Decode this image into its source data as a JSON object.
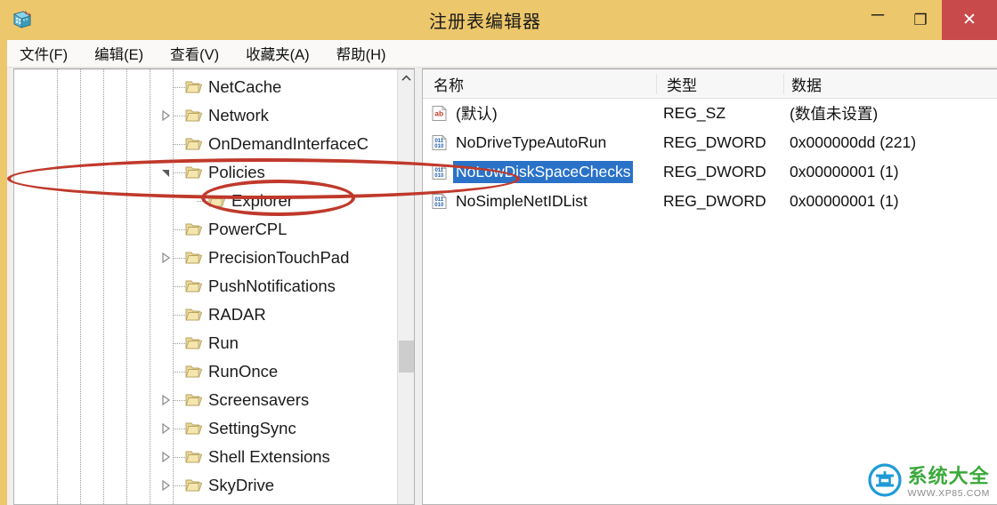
{
  "window": {
    "title": "注册表编辑器",
    "app_icon": "registry-editor-icon",
    "titlebar_color": "#edc76b",
    "close_color": "#c94a4a",
    "controls": {
      "minimize": "─",
      "maximize": "❐",
      "close": "✕"
    }
  },
  "menu": {
    "items": [
      {
        "label": "文件(F)",
        "name": "menu-file"
      },
      {
        "label": "编辑(E)",
        "name": "menu-edit"
      },
      {
        "label": "查看(V)",
        "name": "menu-view"
      },
      {
        "label": "收藏夹(A)",
        "name": "menu-favorites"
      },
      {
        "label": "帮助(H)",
        "name": "menu-help"
      }
    ]
  },
  "tree": {
    "items": [
      {
        "label": "NetCache",
        "indent": 0,
        "twisty": "none",
        "selected": false
      },
      {
        "label": "Network",
        "indent": 0,
        "twisty": "collapsed",
        "selected": false
      },
      {
        "label": "OnDemandInterfaceC",
        "indent": 0,
        "twisty": "none",
        "selected": false
      },
      {
        "label": "Policies",
        "indent": 0,
        "twisty": "expanded",
        "selected": false
      },
      {
        "label": "Explorer",
        "indent": 1,
        "twisty": "none",
        "selected": false
      },
      {
        "label": "PowerCPL",
        "indent": 0,
        "twisty": "none",
        "selected": false
      },
      {
        "label": "PrecisionTouchPad",
        "indent": 0,
        "twisty": "collapsed",
        "selected": false
      },
      {
        "label": "PushNotifications",
        "indent": 0,
        "twisty": "none",
        "selected": false
      },
      {
        "label": "RADAR",
        "indent": 0,
        "twisty": "none",
        "selected": false
      },
      {
        "label": "Run",
        "indent": 0,
        "twisty": "none",
        "selected": false
      },
      {
        "label": "RunOnce",
        "indent": 0,
        "twisty": "none",
        "selected": false
      },
      {
        "label": "Screensavers",
        "indent": 0,
        "twisty": "collapsed",
        "selected": false
      },
      {
        "label": "SettingSync",
        "indent": 0,
        "twisty": "collapsed",
        "selected": false
      },
      {
        "label": "Shell Extensions",
        "indent": 0,
        "twisty": "collapsed",
        "selected": false
      },
      {
        "label": "SkyDrive",
        "indent": 0,
        "twisty": "collapsed",
        "selected": false
      }
    ],
    "scrollbar": {
      "arrow_up": "˄",
      "thumb_position_pct": 66
    }
  },
  "values": {
    "columns": [
      {
        "label": "名称",
        "name": "column-name"
      },
      {
        "label": "类型",
        "name": "column-type"
      },
      {
        "label": "数据",
        "name": "column-data"
      }
    ],
    "rows": [
      {
        "icon": "string-value-icon",
        "name": "(默认)",
        "type": "REG_SZ",
        "data": "(数值未设置)",
        "selected": false
      },
      {
        "icon": "dword-value-icon",
        "name": "NoDriveTypeAutoRun",
        "type": "REG_DWORD",
        "data": "0x000000dd (221)",
        "selected": false
      },
      {
        "icon": "dword-value-icon",
        "name": "NoLowDiskSpaceChecks",
        "type": "REG_DWORD",
        "data": "0x00000001 (1)",
        "selected": true
      },
      {
        "icon": "dword-value-icon",
        "name": "NoSimpleNetIDList",
        "type": "REG_DWORD",
        "data": "0x00000001 (1)",
        "selected": false
      }
    ],
    "selection_color": "#2a72c8"
  },
  "annotations": {
    "color": "#c0392b",
    "ellipse_tree_target": "Explorer",
    "ellipse_value_target": "NoLowDiskSpaceChecks"
  },
  "watermark": {
    "brand": "系统大全",
    "url": "WWW.XP85.COM",
    "brand_color": "#3aa93a",
    "logo_color": "#1e9bd7"
  }
}
